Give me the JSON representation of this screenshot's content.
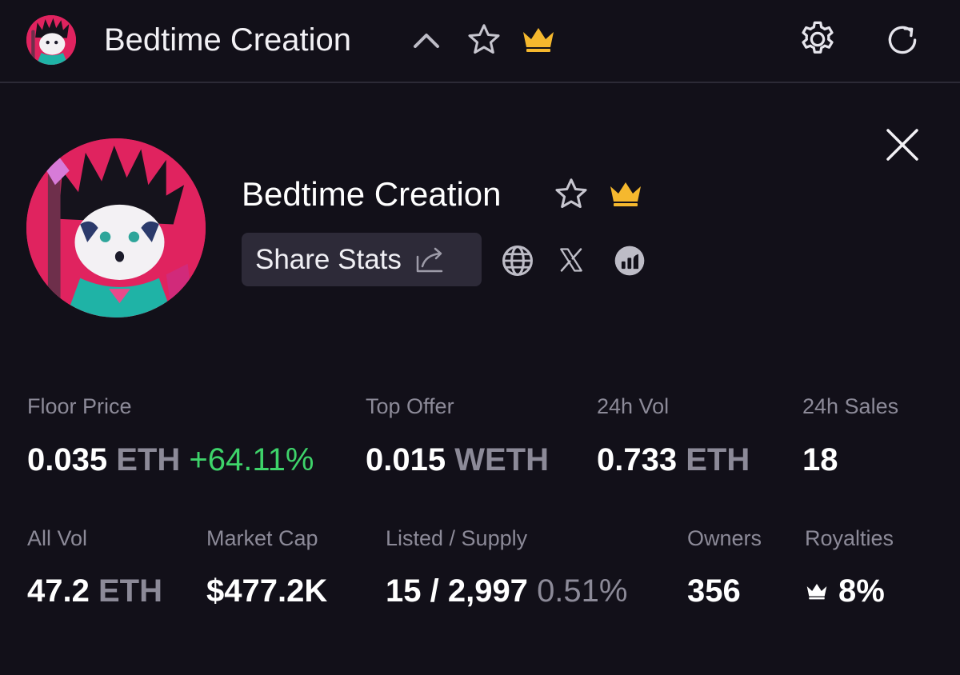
{
  "header": {
    "collection_name": "Bedtime Creation",
    "icons": [
      "chevron-up-icon",
      "star-icon",
      "crown-icon",
      "gear-icon",
      "refresh-icon"
    ]
  },
  "profile": {
    "name": "Bedtime Creation",
    "share_label": "Share Stats",
    "links": [
      "globe-icon",
      "x-icon",
      "chart-icon"
    ]
  },
  "stats": {
    "floor_price": {
      "label": "Floor Price",
      "value": "0.035",
      "unit": "ETH",
      "change": "+64.11%"
    },
    "top_offer": {
      "label": "Top Offer",
      "value": "0.015",
      "unit": "WETH"
    },
    "vol_24h": {
      "label": "24h Vol",
      "value": "0.733",
      "unit": "ETH"
    },
    "sales_24h": {
      "label": "24h Sales",
      "value": "18"
    },
    "all_vol": {
      "label": "All Vol",
      "value": "47.2",
      "unit": "ETH"
    },
    "market_cap": {
      "label": "Market Cap",
      "value": "$477.2K"
    },
    "listed_supply": {
      "label": "Listed / Supply",
      "value": "15 / 2,997",
      "percent": "0.51%"
    },
    "owners": {
      "label": "Owners",
      "value": "356"
    },
    "royalties": {
      "label": "Royalties",
      "value": "8%"
    }
  },
  "colors": {
    "background": "#121019",
    "accent_gold": "#f5b82e",
    "positive": "#3ed36a",
    "muted": "#8c8a98",
    "avatar_bg": "#e0235f"
  }
}
